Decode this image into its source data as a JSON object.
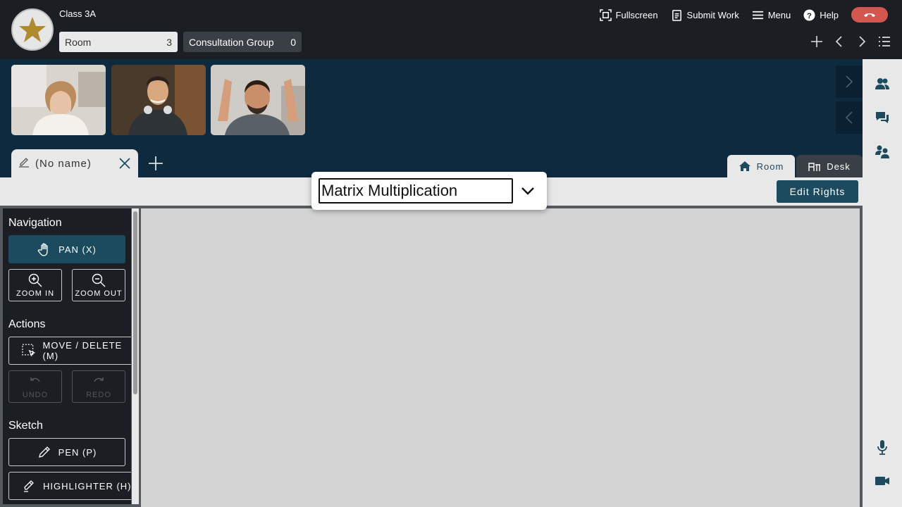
{
  "header": {
    "class_name": "Class 3A",
    "room_label": "Room",
    "room_count": "3",
    "group_label": "Consultation Group",
    "group_count": "0",
    "actions": {
      "fullscreen": "Fullscreen",
      "submit_work": "Submit Work",
      "menu": "Menu",
      "help": "Help"
    }
  },
  "tabs": {
    "doc_tab_label": "(No name)",
    "room_tab": "Room",
    "desk_tab": "Desk"
  },
  "toolbar": {
    "edit_rights": "Edit Rights"
  },
  "title_popup": {
    "value": "Matrix Multiplication"
  },
  "tools": {
    "navigation_title": "Navigation",
    "pan": "PAN (X)",
    "zoom_in": "ZOOM IN",
    "zoom_out": "ZOOM OUT",
    "actions_title": "Actions",
    "move_delete": "MOVE / DELETE (M)",
    "undo": "UNDO",
    "redo": "REDO",
    "sketch_title": "Sketch",
    "pen": "PEN (P)",
    "highlighter": "HIGHLIGHTER (H)"
  },
  "colors": {
    "accent": "#1c4a5e",
    "hangup": "#d4574f",
    "video_strip_bg": "#0e2a3e",
    "topbar_bg": "#1b1e22"
  }
}
